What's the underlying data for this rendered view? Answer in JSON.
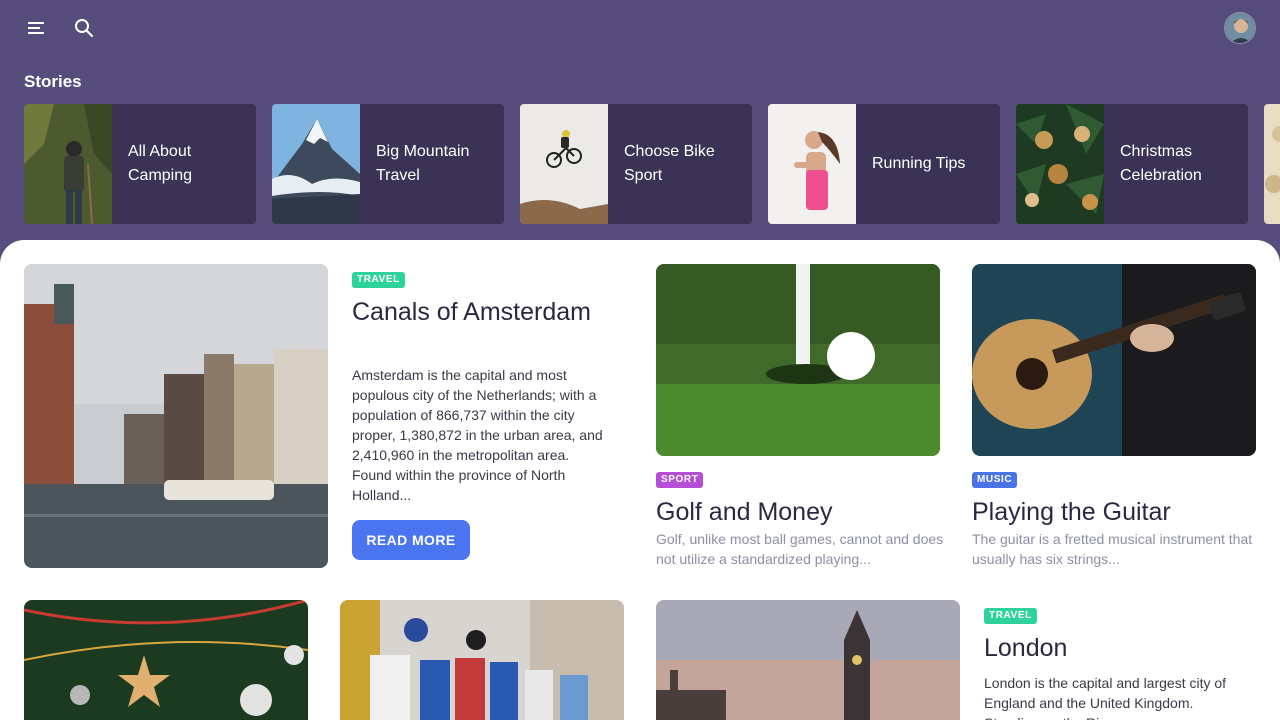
{
  "header": {
    "menu_icon": "hamburger-menu-icon",
    "search_icon": "search-icon",
    "avatar": "user-avatar"
  },
  "stories": {
    "title": "Stories",
    "items": [
      {
        "label": "All About Camping"
      },
      {
        "label": "Big Mountain Travel"
      },
      {
        "label": "Choose Bike Sport"
      },
      {
        "label": "Running Tips"
      },
      {
        "label": "Christmas Celebration"
      }
    ]
  },
  "articles": {
    "amsterdam": {
      "tag": "TRAVEL",
      "title": "Canals of Amsterdam",
      "text": "Amsterdam is the capital and most populous city of the Netherlands; with a population of 866,737 within the city proper, 1,380,872 in the urban area, and 2,410,960 in the metropolitan area. Found within the province of North Holland...",
      "button": "READ MORE"
    },
    "golf": {
      "tag": "SPORT",
      "title": "Golf and Money",
      "text": "Golf, unlike most ball games, cannot and does not utilize a standardized playing..."
    },
    "guitar": {
      "tag": "MUSIC",
      "title": "Playing the Guitar",
      "text": "The guitar is a fretted musical instrument that usually has six strings..."
    },
    "london": {
      "tag": "TRAVEL",
      "title": "London",
      "text": "London is the capital and largest city of England and the United Kingdom. Standing on the River..."
    }
  },
  "colors": {
    "header_bg": "#574d7d",
    "story_card_bg": "#3b3356",
    "button_bg": "#4a74f0",
    "tag_travel": "#2ed39a",
    "tag_sport": "#b44fd6",
    "tag_music": "#4a73e8"
  }
}
